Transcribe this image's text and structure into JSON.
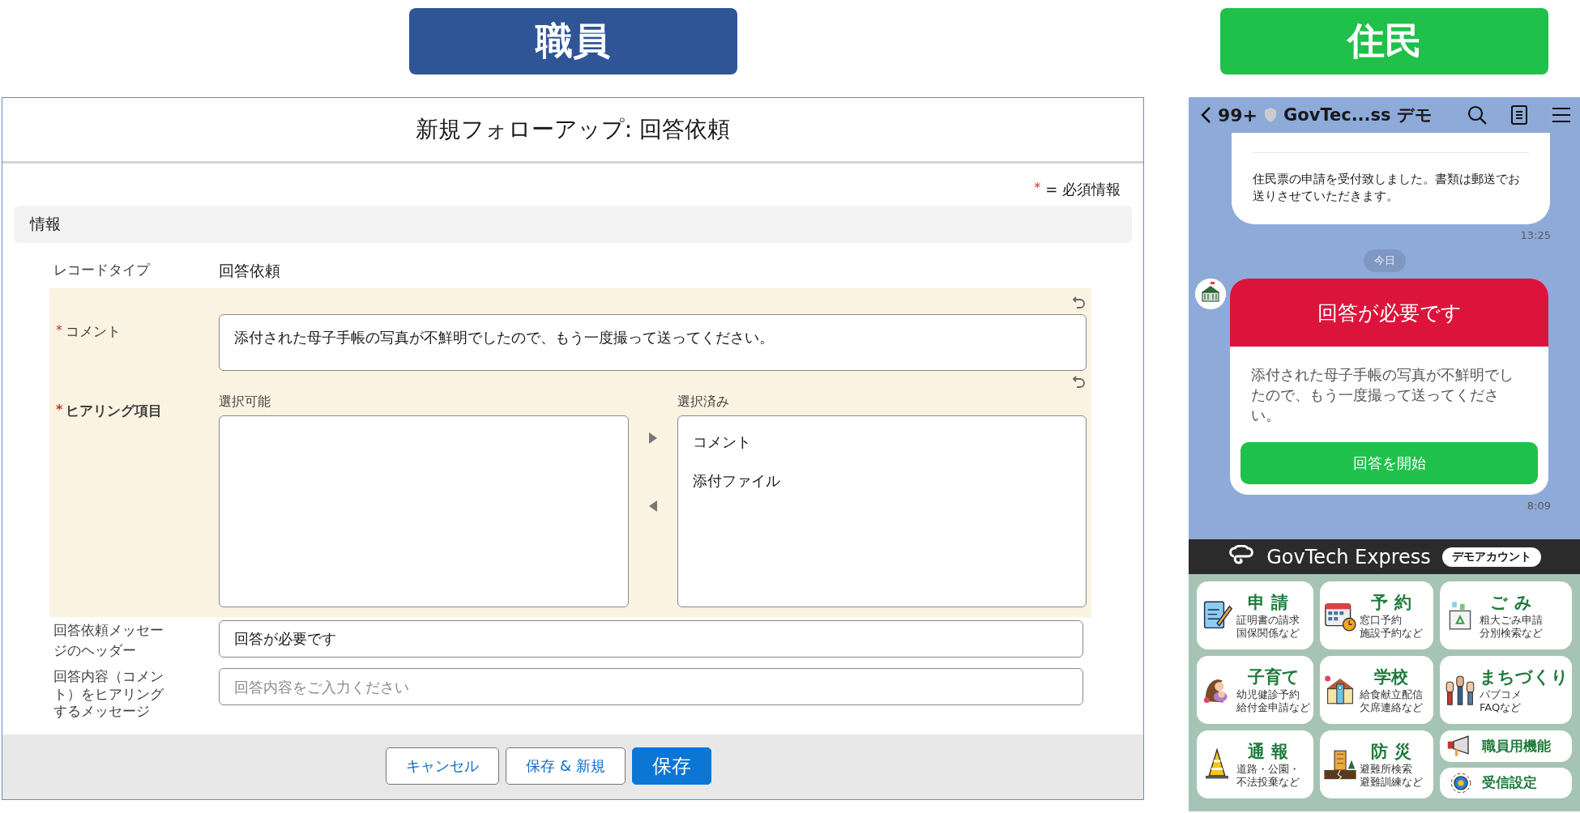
{
  "labels": [
    {
      "text": "職員",
      "kind": "staff"
    },
    {
      "text": "住民",
      "kind": "resident"
    }
  ],
  "form": {
    "title": "新規フォローアップ: 回答依頼",
    "required_note": {
      "mark": "*",
      "text": "= 必須情報"
    },
    "section": "情報",
    "record_type": {
      "label": "レコードタイプ",
      "value": "回答依頼"
    },
    "comment": {
      "mark": "*",
      "label": "コメント",
      "value": "添付された母子手帳の写真が不鮮明でしたので、もう一度撮って送ってください。"
    },
    "hearing": {
      "mark": "*",
      "label": "ヒアリング項目",
      "available_label": "選択可能",
      "selected_label": "選択済み",
      "selected_items": [
        "コメント",
        "添付ファイル"
      ]
    },
    "header_field": {
      "label": "回答依頼メッセージのヘッダー",
      "value": "回答が必要です"
    },
    "message_field": {
      "label": "回答内容（コメント）をヒアリングするメッセージ",
      "placeholder": "回答内容をご入力ください"
    },
    "buttons": [
      {
        "label": "キャンセル",
        "kind": "neutral"
      },
      {
        "label": "保存 & 新規",
        "kind": "neutral"
      },
      {
        "label": "保存",
        "kind": "brand"
      }
    ]
  },
  "chat": {
    "back_count": "99+",
    "title": "GovTec...ss デモ",
    "messages": [
      {
        "kind": "text",
        "text": "住民票の申請を受付致しました。書類は郵送でお送りさせていただきます。",
        "time": "13:25"
      },
      {
        "kind": "date",
        "text": "今日"
      },
      {
        "kind": "card",
        "header": "回答が必要です",
        "body": "添付された母子手帳の写真が不鮮明でしたので、もう一度撮って送ってください。",
        "button": "回答を開始",
        "time": "8:09"
      }
    ]
  },
  "rich_menu": {
    "brand": "GovTech Express",
    "badge": "デモアカウント",
    "tiles": [
      {
        "kind": "large",
        "title": "申 請",
        "lines": [
          "証明書の請求",
          "国保関係など"
        ]
      },
      {
        "kind": "large",
        "title": "予 約",
        "lines": [
          "窓口予約",
          "施設予約など"
        ]
      },
      {
        "kind": "large",
        "title": "ご み",
        "lines": [
          "粗大ごみ申請",
          "分別検索など"
        ]
      },
      {
        "kind": "large",
        "title": "子育て",
        "lines": [
          "幼児健診予約",
          "給付金申請など"
        ]
      },
      {
        "kind": "large",
        "title": "学校",
        "lines": [
          "給食献立配信",
          "欠席連絡など"
        ]
      },
      {
        "kind": "large",
        "title": "まちづくり",
        "lines": [
          "パブコメ",
          "FAQなど"
        ]
      },
      {
        "kind": "large",
        "title": "通 報",
        "lines": [
          "道路・公園・",
          "不法投棄など"
        ]
      },
      {
        "kind": "large",
        "title": "防 災",
        "lines": [
          "避難所検索",
          "避難訓練など"
        ]
      },
      {
        "kind": "small",
        "title": "職員用機能"
      },
      {
        "kind": "small",
        "title": "受信設定"
      }
    ]
  }
}
